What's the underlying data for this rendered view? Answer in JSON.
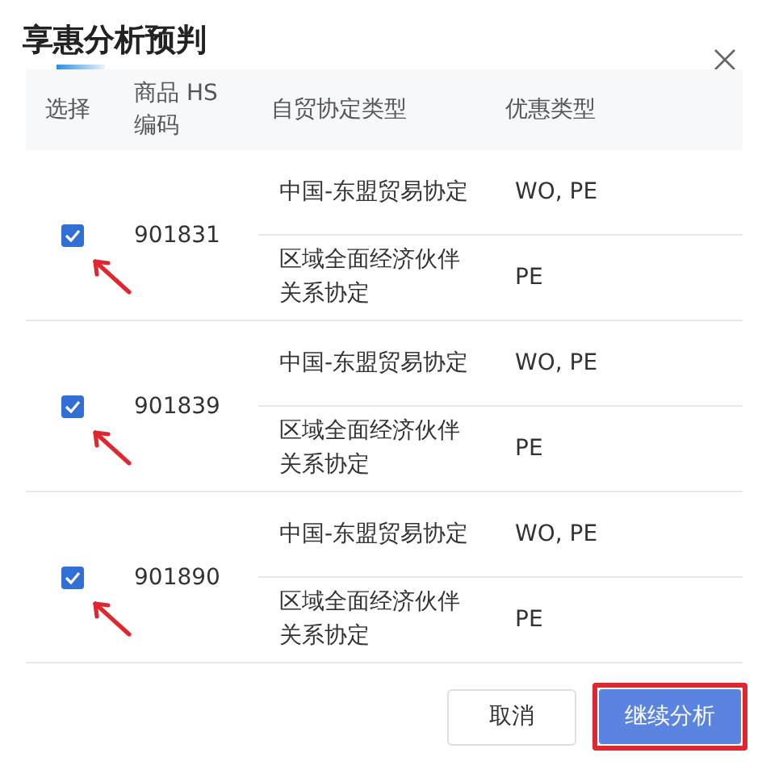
{
  "dialog": {
    "title": "享惠分析预判"
  },
  "table": {
    "columns": [
      "选择",
      "商品 HS 编码",
      "自贸协定类型",
      "优惠类型"
    ],
    "rows": [
      {
        "checked": true,
        "hs_code": "901831",
        "agreements": [
          {
            "name": "中国-东盟贸易协定",
            "preference": "WO, PE"
          },
          {
            "name": "区域全面经济伙伴关系协定",
            "preference": "PE"
          }
        ]
      },
      {
        "checked": true,
        "hs_code": "901839",
        "agreements": [
          {
            "name": "中国-东盟贸易协定",
            "preference": "WO, PE"
          },
          {
            "name": "区域全面经济伙伴关系协定",
            "preference": "PE"
          }
        ]
      },
      {
        "checked": true,
        "hs_code": "901890",
        "agreements": [
          {
            "name": "中国-东盟贸易协定",
            "preference": "WO, PE"
          },
          {
            "name": "区域全面经济伙伴关系协定",
            "preference": "PE"
          }
        ]
      }
    ]
  },
  "buttons": {
    "cancel": "取消",
    "confirm": "继续分析"
  }
}
